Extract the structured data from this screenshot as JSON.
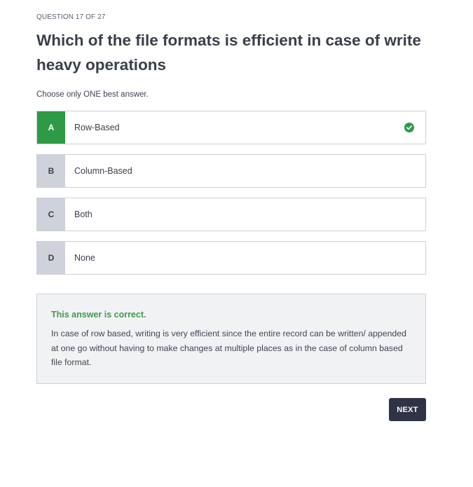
{
  "question": {
    "counter": "QUESTION 17 OF 27",
    "title": "Which of the file formats is efficient in case of write heavy operations",
    "instruction": "Choose only ONE best answer."
  },
  "options": [
    {
      "letter": "A",
      "label": "Row-Based",
      "selected": true,
      "correct": true
    },
    {
      "letter": "B",
      "label": "Column-Based",
      "selected": false
    },
    {
      "letter": "C",
      "label": "Both",
      "selected": false
    },
    {
      "letter": "D",
      "label": "None",
      "selected": false
    }
  ],
  "feedback": {
    "title": "This answer is correct.",
    "body": "In case of row based, writing is very efficient since the entire record can be written/ appended at one go without having to make changes at multiple places as in the case of column based file format."
  },
  "actions": {
    "next_label": "NEXT"
  },
  "colors": {
    "correct_green": "#2f9a45",
    "feedback_title_green": "#3f9a4f",
    "letter_bg": "#cfd2da",
    "button_bg": "#2f3345"
  },
  "icons": {
    "correct": "check-circle-icon"
  }
}
